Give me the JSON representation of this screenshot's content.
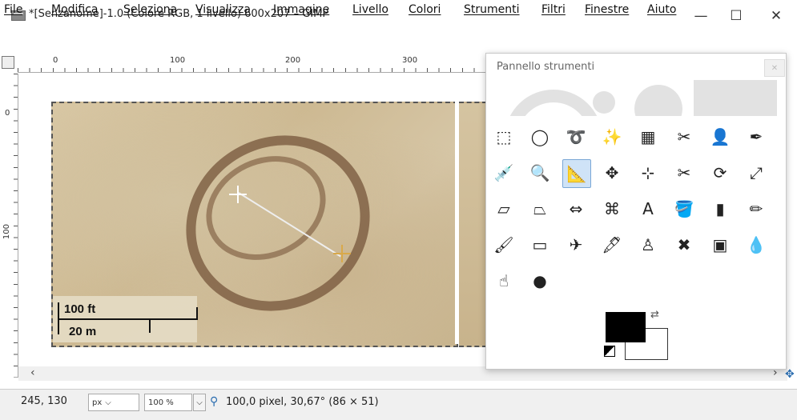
{
  "window": {
    "title": "*[Senzanome]-1.0 (Colore RGB, 1 livello) 600x207 – GIMP",
    "minimize": "—",
    "maximize": "☐",
    "close": "✕"
  },
  "menubar": [
    "File",
    "Modifica",
    "Seleziona",
    "Visualizza",
    "Immagine",
    "Livello",
    "Colori",
    "Strumenti",
    "Filtri",
    "Finestre",
    "Aiuto"
  ],
  "ruler": {
    "h_labels": [
      "0",
      "100",
      "200",
      "300"
    ],
    "v_labels": [
      "0",
      "100"
    ]
  },
  "canvas": {
    "scale_ft": "100 ft",
    "scale_m": "20 m"
  },
  "toolbox": {
    "title": "Pannello strumenti",
    "close_icon": "close-icon",
    "tools": [
      {
        "name": "rect-select-tool",
        "glyph": "⬚"
      },
      {
        "name": "ellipse-select-tool",
        "glyph": "◯"
      },
      {
        "name": "free-select-tool",
        "glyph": "➰"
      },
      {
        "name": "fuzzy-select-tool",
        "glyph": "✨"
      },
      {
        "name": "select-by-color-tool",
        "glyph": "▦"
      },
      {
        "name": "scissors-select-tool",
        "glyph": "✂"
      },
      {
        "name": "foreground-select-tool",
        "glyph": "👤"
      },
      {
        "name": "paths-tool",
        "glyph": "✒"
      },
      {
        "name": "color-picker-tool",
        "glyph": "💉"
      },
      {
        "name": "zoom-tool",
        "glyph": "🔍"
      },
      {
        "name": "measure-tool",
        "glyph": "📐",
        "selected": true
      },
      {
        "name": "move-tool",
        "glyph": "✥"
      },
      {
        "name": "align-tool",
        "glyph": "⊹"
      },
      {
        "name": "crop-tool",
        "glyph": "✂"
      },
      {
        "name": "rotate-tool",
        "glyph": "⟳"
      },
      {
        "name": "scale-tool",
        "glyph": "⤢"
      },
      {
        "name": "shear-tool",
        "glyph": "▱"
      },
      {
        "name": "perspective-tool",
        "glyph": "⏢"
      },
      {
        "name": "flip-tool",
        "glyph": "⇔"
      },
      {
        "name": "cage-transform-tool",
        "glyph": "⌘"
      },
      {
        "name": "text-tool",
        "glyph": "A"
      },
      {
        "name": "bucket-fill-tool",
        "glyph": "🪣"
      },
      {
        "name": "blend-tool",
        "glyph": "▮"
      },
      {
        "name": "pencil-tool",
        "glyph": "✏"
      },
      {
        "name": "paintbrush-tool",
        "glyph": "🖌"
      },
      {
        "name": "eraser-tool",
        "glyph": "▭"
      },
      {
        "name": "airbrush-tool",
        "glyph": "✈"
      },
      {
        "name": "ink-tool",
        "glyph": "🖋"
      },
      {
        "name": "clone-tool",
        "glyph": "♙"
      },
      {
        "name": "heal-tool",
        "glyph": "✖"
      },
      {
        "name": "perspective-clone-tool",
        "glyph": "▣"
      },
      {
        "name": "blur-sharpen-tool",
        "glyph": "💧"
      },
      {
        "name": "smudge-tool",
        "glyph": "☝"
      },
      {
        "name": "dodge-burn-tool",
        "glyph": "●"
      }
    ]
  },
  "statusbar": {
    "coords": "245, 130",
    "unit": "px",
    "zoom": "100 %",
    "message": "100,0 pixel, 30,67° (86 × 51)"
  }
}
